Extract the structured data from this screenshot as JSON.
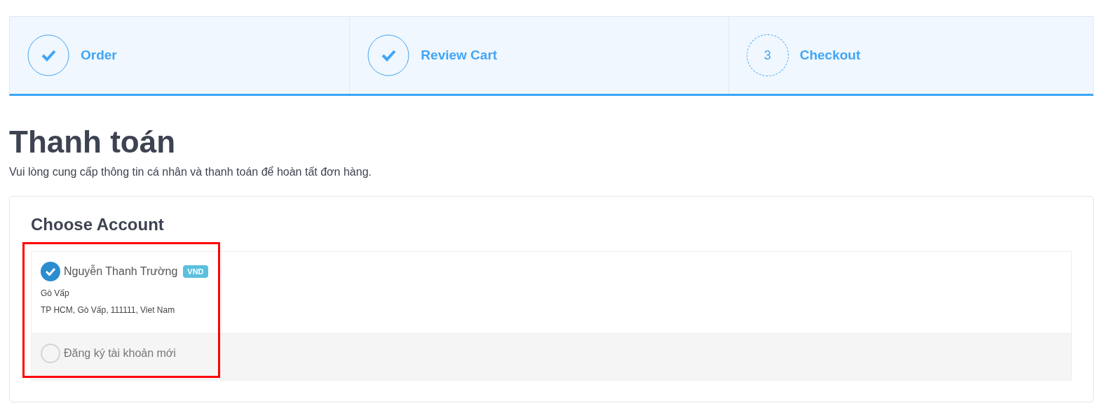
{
  "steps": [
    {
      "label": "Order",
      "done": true
    },
    {
      "label": "Review Cart",
      "done": true
    },
    {
      "label": "Checkout",
      "done": false,
      "number": "3"
    }
  ],
  "title": "Thanh toán",
  "subtitle": "Vui lòng cung cấp thông tin cá nhân và thanh toán để hoàn tất đơn hàng.",
  "account_card": {
    "title": "Choose Account",
    "highlighted": true,
    "options": [
      {
        "kind": "account",
        "name": "Nguyễn Thanh Trường",
        "badge": "VND",
        "lines": [
          "Gò Vấp",
          "TP HCM, Gò Vấp, 111111, Viet Nam"
        ],
        "selected": true
      },
      {
        "kind": "new",
        "name": "Đăng ký tài khoản mới",
        "selected": false
      }
    ]
  }
}
